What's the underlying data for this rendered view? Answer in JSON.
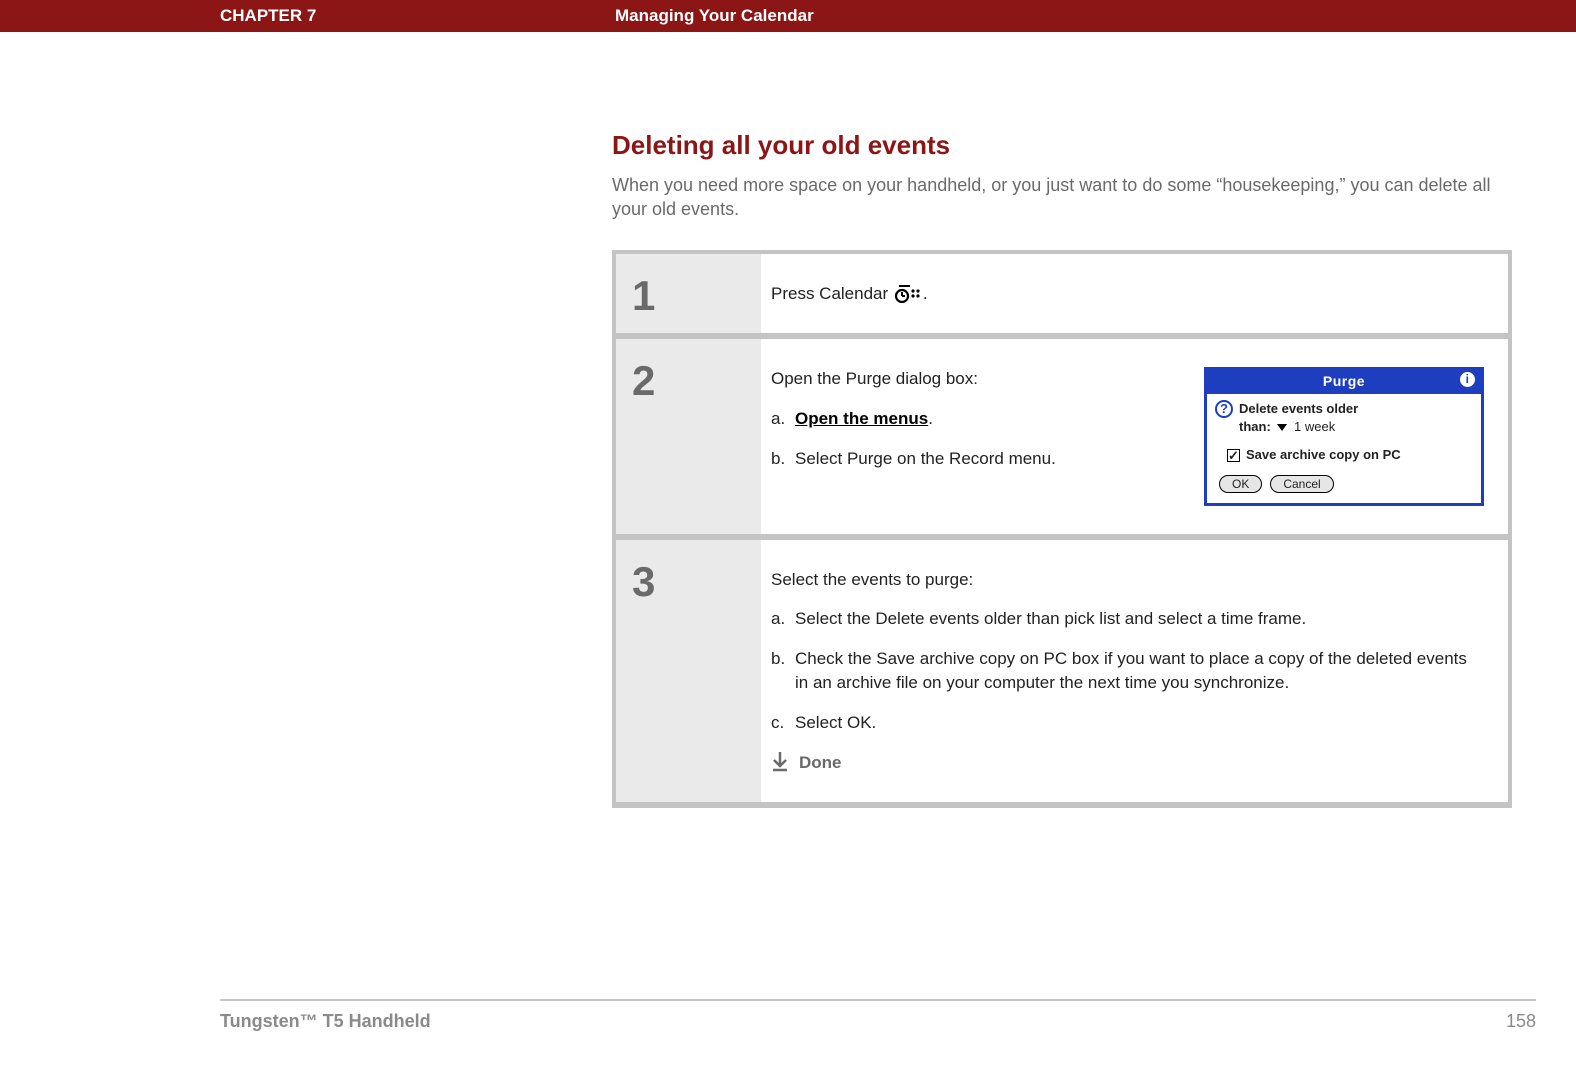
{
  "header": {
    "chapter": "CHAPTER 7",
    "title": "Managing Your Calendar"
  },
  "section": {
    "title": "Deleting all your old events",
    "intro": "When you need more space on your handheld, or you just want to do some “housekeeping,” you can delete all your old events."
  },
  "steps": {
    "s1": {
      "num": "1",
      "text_a": "Press Calendar ",
      "text_b": "."
    },
    "s2": {
      "num": "2",
      "intro": "Open the Purge dialog box:",
      "a_label": "a.",
      "a_link": "Open the menus",
      "a_tail": ".",
      "b_label": "b.",
      "b_text": "Select Purge on the Record menu."
    },
    "s3": {
      "num": "3",
      "intro": "Select the events to purge:",
      "a_label": "a.",
      "a_text": "Select the Delete events older than pick list and select a time frame.",
      "b_label": "b.",
      "b_text": "Check the Save archive copy on PC box if you want to place a copy of the deleted events in an archive file on your computer the next time you synchronize.",
      "c_label": "c.",
      "c_text": "Select OK.",
      "done": "Done"
    }
  },
  "purge": {
    "title": "Purge",
    "line1": "Delete events older",
    "than_label": "than:",
    "week": "1 week",
    "save_label": "Save archive copy on PC",
    "ok": "OK",
    "cancel": "Cancel"
  },
  "footer": {
    "product_bold": "Tungsten™ T5 ",
    "product_light": "Handheld",
    "page": "158"
  }
}
